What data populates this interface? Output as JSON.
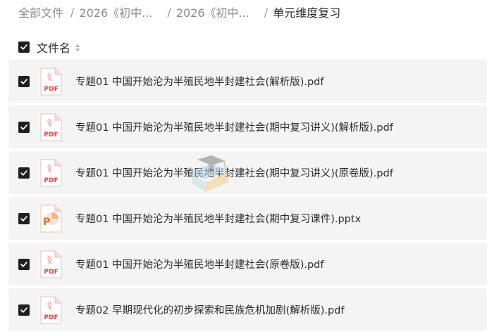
{
  "breadcrumb": {
    "items": [
      {
        "label": "全部文件"
      },
      {
        "label": "2026《初中..."
      },
      {
        "label": "2026《初中..."
      }
    ],
    "current": "单元维度复习",
    "separator": "/"
  },
  "list_header": {
    "column_label": "文件名",
    "select_all_checked": true
  },
  "files": [
    {
      "name": "专题01 中国开始沦为半殖民地半封建社会(解析版).pdf",
      "type": "pdf",
      "icon_label": "PDF",
      "checked": true
    },
    {
      "name": "专题01 中国开始沦为半殖民地半封建社会(期中复习讲义)(解析版).pdf",
      "type": "pdf",
      "icon_label": "PDF",
      "checked": true
    },
    {
      "name": "专题01 中国开始沦为半殖民地半封建社会(期中复习讲义)(原卷版).pdf",
      "type": "pdf",
      "icon_label": "PDF",
      "checked": true
    },
    {
      "name": "专题01 中国开始沦为半殖民地半封建社会(期中复习课件).pptx",
      "type": "pptx",
      "icon_label": "P",
      "checked": true
    },
    {
      "name": "专题01 中国开始沦为半殖民地半封建社会(原卷版).pdf",
      "type": "pdf",
      "icon_label": "PDF",
      "checked": true
    },
    {
      "name": "专题02 早期现代化的初步探索和民族危机加剧(解析版).pdf",
      "type": "pdf",
      "icon_label": "PDF",
      "checked": true
    }
  ],
  "colors": {
    "row_bg": "#f4f4f5",
    "pdf_red": "#e8483f",
    "pptx_orange": "#ef6b2f",
    "checkbox": "#1f1f1f"
  }
}
